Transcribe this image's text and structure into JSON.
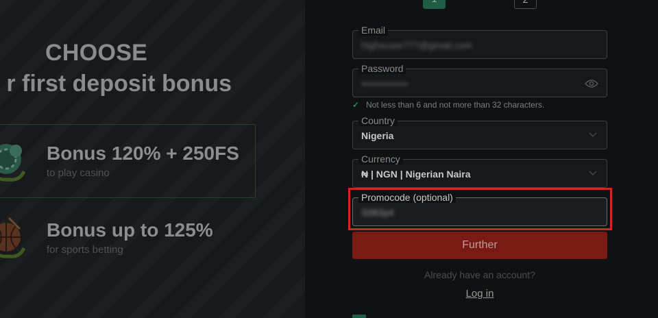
{
  "left": {
    "heading_line1": "CHOOSE",
    "heading_line2": "r first deposit bonus",
    "bonuses": [
      {
        "title": "Bonus 120% + 250FS",
        "subtitle": "to play casino",
        "icon": "casino-chips-icon"
      },
      {
        "title": "Bonus up to 125%",
        "subtitle": "for sports betting",
        "icon": "sports-ball-icon"
      }
    ]
  },
  "steps": [
    "1",
    "2"
  ],
  "form": {
    "email": {
      "label": "Email",
      "value": "highscore777@gmail.com"
    },
    "password": {
      "label": "Password",
      "value": "••••••••••••••",
      "icon": "eye-icon"
    },
    "password_hint": "Not less than 6 and not more than 32 characters.",
    "country": {
      "label": "Country",
      "value": "Nigeria"
    },
    "currency": {
      "label": "Currency",
      "value": "₦ | NGN | Nigerian Naira"
    },
    "promocode": {
      "label": "Promocode (optional)",
      "value": "S063y4"
    },
    "further_label": "Further",
    "already_text": "Already have an account?",
    "login_label": "Log in"
  },
  "colors": {
    "accent_green": "#1f5e45",
    "button_red": "#7a1a14",
    "highlight_red": "#d0281f"
  }
}
